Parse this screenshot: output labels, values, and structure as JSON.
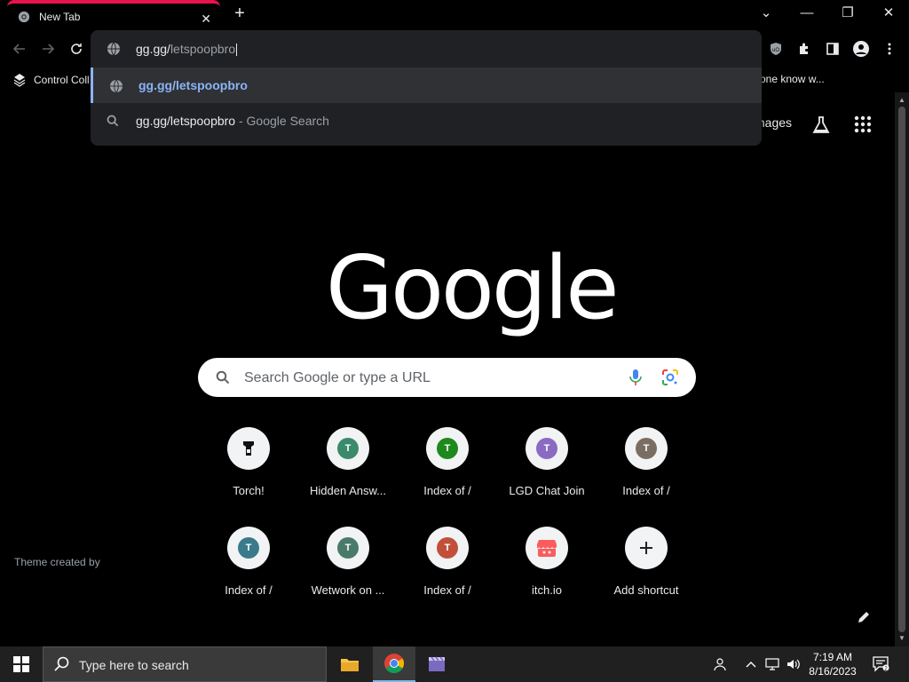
{
  "browser": {
    "tab_title": "New Tab",
    "bookmarks": [
      {
        "label": "Control Coll"
      },
      {
        "label": "one know w..."
      }
    ]
  },
  "omnibox": {
    "typed": "gg.gg/",
    "typed_suffix": "letspoopbro",
    "suggestions": [
      {
        "text": "gg.gg/letspoopbro",
        "desc": "",
        "icon": "globe-icon"
      },
      {
        "text": "gg.gg/letspoopbro",
        "desc": " - Google Search",
        "icon": "search-icon"
      }
    ]
  },
  "ntp": {
    "images_link": "mages",
    "logo": "Google",
    "search_placeholder": "Search Google or type a URL",
    "shortcuts": [
      {
        "label": "Torch!",
        "letter": "",
        "color": ""
      },
      {
        "label": "Hidden Answ...",
        "letter": "T",
        "color": "#3a8a6b"
      },
      {
        "label": "Index of /",
        "letter": "T",
        "color": "#1e8a1e"
      },
      {
        "label": "LGD Chat Join",
        "letter": "T",
        "color": "#8a6ac2"
      },
      {
        "label": "Index of /",
        "letter": "T",
        "color": "#7a6e63"
      },
      {
        "label": "Index of /",
        "letter": "T",
        "color": "#3a7a8a"
      },
      {
        "label": "Wetwork on ...",
        "letter": "T",
        "color": "#4a7a6a"
      },
      {
        "label": "Index of /",
        "letter": "T",
        "color": "#c0503a"
      },
      {
        "label": "itch.io",
        "letter": "",
        "color": "#fa5c5c"
      },
      {
        "label": "Add shortcut",
        "letter": "+",
        "color": ""
      }
    ],
    "theme_credit": "Theme created by"
  },
  "taskbar": {
    "search_placeholder": "Type here to search",
    "time": "7:19 AM",
    "date": "8/16/2023"
  }
}
